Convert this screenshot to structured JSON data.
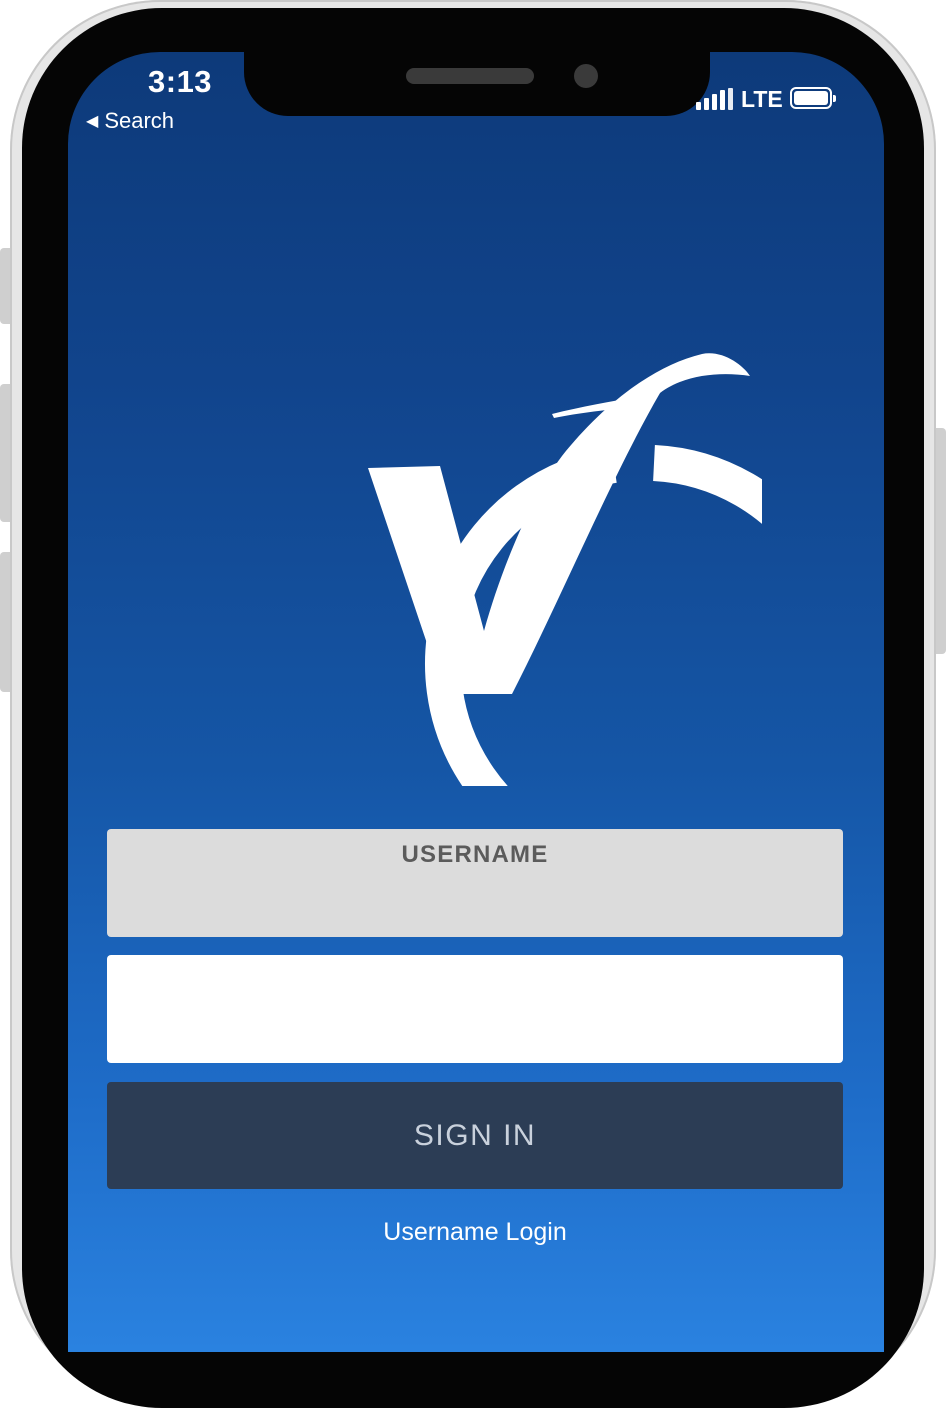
{
  "status_bar": {
    "time": "3:13",
    "back_label": "Search",
    "network": "LTE"
  },
  "logo": {
    "icon": "checkmark-v-logo",
    "color": "#ffffff"
  },
  "login_form": {
    "username_label": "USERNAME",
    "password_value": "",
    "sign_in_label": "SIGN IN",
    "alt_login_label": "Username Login"
  },
  "colors": {
    "background_top": "#0d3a7a",
    "background_bottom": "#2a82e0",
    "button": "#2c3d55",
    "username_field": "#dcdcdc"
  }
}
